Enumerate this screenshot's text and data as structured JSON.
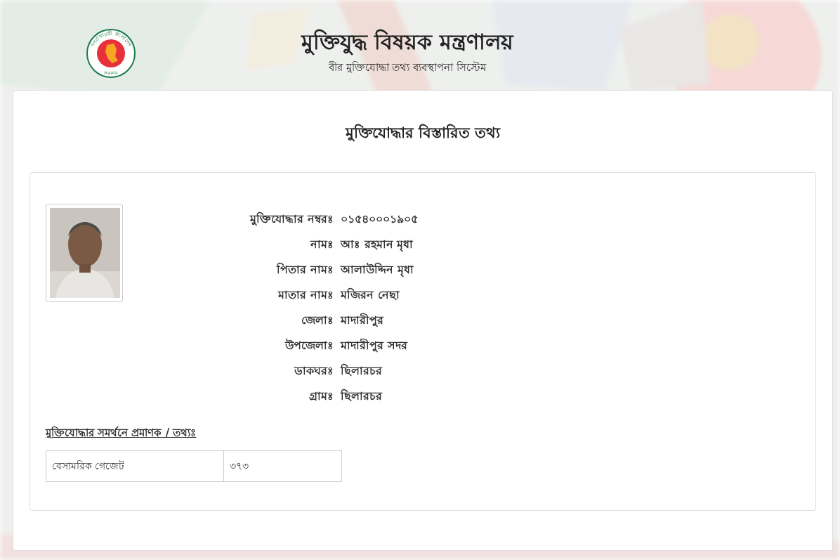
{
  "header": {
    "seal_top": "গণপ্রজাতন্ত্রী বাংলাদেশ",
    "seal_bottom": "সরকার",
    "title": "মুক্তিযুদ্ধ বিষয়ক মন্ত্রণালয়",
    "subtitle": "বীর মুক্তিযোদ্ধা তথ্য ব্যবস্থাপনা সিস্টেম"
  },
  "page_title": "মুক্তিযোদ্ধার বিস্তারিত তথ্য",
  "profile": {
    "fields": [
      {
        "label": "মুক্তিযোদ্ধার নম্বরঃ",
        "value": "০১৫৪০০০১৯০৫"
      },
      {
        "label": "নামঃ",
        "value": "আঃ রহমান মৃধা"
      },
      {
        "label": "পিতার নামঃ",
        "value": "আলাউদ্দিন মৃধা"
      },
      {
        "label": "মাতার নামঃ",
        "value": "মজিরন নেছা"
      },
      {
        "label": "জেলাঃ",
        "value": "মাদারীপুর"
      },
      {
        "label": "উপজেলাঃ",
        "value": "মাদারীপুর সদর"
      },
      {
        "label": "ডাকঘরঃ",
        "value": "ছিলারচর"
      },
      {
        "label": "গ্রামঃ",
        "value": "ছিলারচর"
      }
    ]
  },
  "evidence": {
    "heading": "মুক্তিযোদ্ধার সমর্থনে প্রমাণক / তথ্যঃ",
    "rows": [
      {
        "cells": [
          "বেসামরিক গেজেট",
          "৩৭৩"
        ]
      }
    ]
  }
}
